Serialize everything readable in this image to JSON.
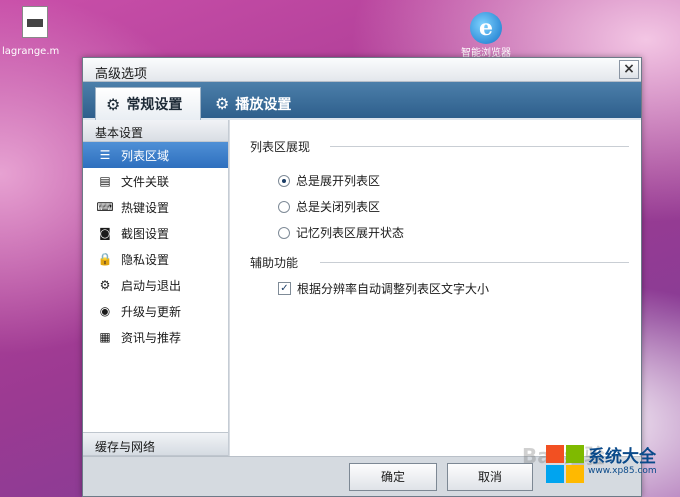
{
  "desktop": {
    "file_icon_label": "lagrange.m",
    "ie_icon_label": "智能浏览器"
  },
  "window": {
    "title": "高级选项",
    "close_label": "×"
  },
  "tabs": [
    {
      "label": "常规设置",
      "icon": "gear-icon",
      "active": true
    },
    {
      "label": "播放设置",
      "icon": "play-settings-icon",
      "active": false
    }
  ],
  "sidebar": {
    "header": "基本设置",
    "items": [
      {
        "label": "列表区域",
        "icon": "list-icon",
        "selected": true
      },
      {
        "label": "文件关联",
        "icon": "file-link-icon",
        "selected": false
      },
      {
        "label": "热键设置",
        "icon": "hotkey-icon",
        "selected": false
      },
      {
        "label": "截图设置",
        "icon": "camera-icon",
        "selected": false
      },
      {
        "label": "隐私设置",
        "icon": "lock-icon",
        "selected": false
      },
      {
        "label": "启动与退出",
        "icon": "power-gear-icon",
        "selected": false
      },
      {
        "label": "升级与更新",
        "icon": "update-globe-icon",
        "selected": false
      },
      {
        "label": "资讯与推荐",
        "icon": "news-icon",
        "selected": false
      }
    ],
    "footer": "缓存与网络"
  },
  "content": {
    "section1_title": "列表区展现",
    "radios": [
      {
        "label": "总是展开列表区",
        "checked": true
      },
      {
        "label": "总是关闭列表区",
        "checked": false
      },
      {
        "label": "记忆列表区展开状态",
        "checked": false
      }
    ],
    "section2_title": "辅助功能",
    "checkbox": {
      "label": "根据分辨率自动调整列表区文字大小",
      "checked": true
    }
  },
  "buttons": {
    "ok": "确定",
    "cancel": "取消"
  },
  "watermark": {
    "site_name": "系统大全",
    "site_url": "www.xp85.com",
    "baidu": "Bai 经验"
  }
}
